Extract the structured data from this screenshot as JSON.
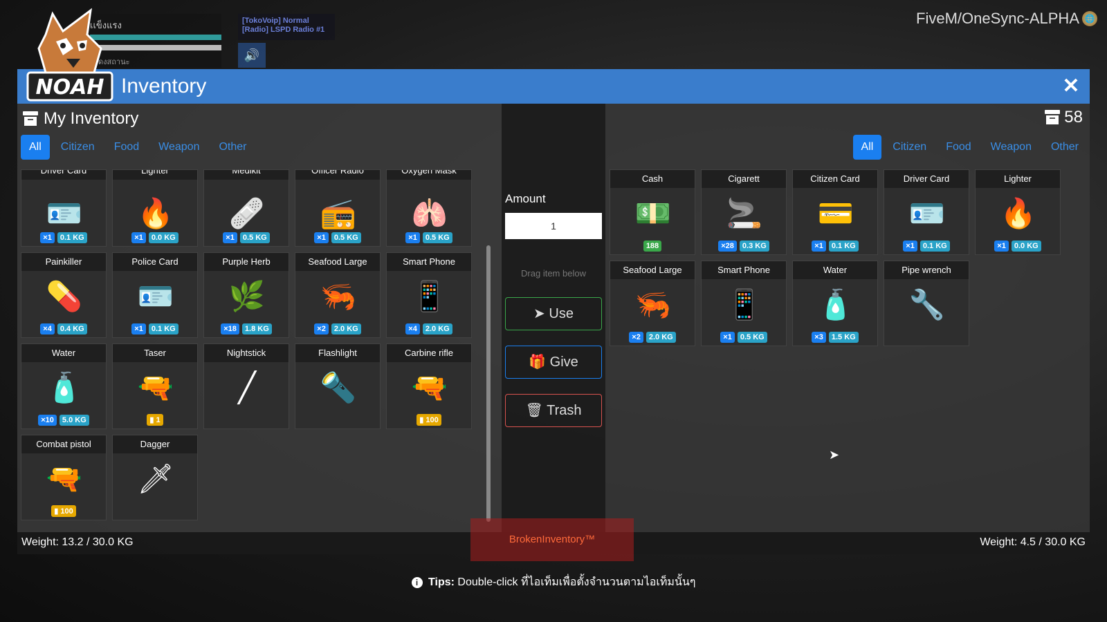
{
  "hud": {
    "label": "เเข็งแรง",
    "subtext": "ค้างไว้เพื่อแสดงสถานะ",
    "radio_line1": "[TokoVoip] Normal",
    "radio_line2": "[Radio] LSPD Radio #1",
    "server_name": "FiveM/OneSync-ALPHA"
  },
  "header": {
    "logo_text": "NOAH",
    "title": "Inventory"
  },
  "left": {
    "title": "My Inventory",
    "tabs": [
      "All",
      "Citizen",
      "Food",
      "Weapon",
      "Other"
    ],
    "items": [
      {
        "name": "Driver Card",
        "qty": "×1",
        "wt": "0.1 KG",
        "icon": "id-card-icon",
        "glyph": "🪪"
      },
      {
        "name": "Lighter",
        "qty": "×1",
        "wt": "0.0 KG",
        "icon": "lighter-icon",
        "glyph": "🔥"
      },
      {
        "name": "Medikit",
        "qty": "×1",
        "wt": "0.5 KG",
        "icon": "medkit-icon",
        "glyph": "🩹"
      },
      {
        "name": "Officer Radio",
        "qty": "×1",
        "wt": "0.5 KG",
        "icon": "radio-icon",
        "glyph": "📻"
      },
      {
        "name": "Oxygen Mask",
        "qty": "×1",
        "wt": "0.5 KG",
        "icon": "oxygen-tank-icon",
        "glyph": "🫁"
      },
      {
        "name": "Painkiller",
        "qty": "×4",
        "wt": "0.4 KG",
        "icon": "pill-bottle-icon",
        "glyph": "💊"
      },
      {
        "name": "Police Card",
        "qty": "×1",
        "wt": "0.1 KG",
        "icon": "badge-card-icon",
        "glyph": "🪪"
      },
      {
        "name": "Purple Herb",
        "qty": "×18",
        "wt": "1.8 KG",
        "icon": "herb-icon",
        "glyph": "🌿"
      },
      {
        "name": "Seafood Large",
        "qty": "×2",
        "wt": "2.0 KG",
        "icon": "seafood-box-icon",
        "glyph": "🦐"
      },
      {
        "name": "Smart Phone",
        "qty": "×4",
        "wt": "2.0 KG",
        "icon": "phone-icon",
        "glyph": "📱"
      },
      {
        "name": "Water",
        "qty": "×10",
        "wt": "5.0 KG",
        "icon": "water-bottle-icon",
        "glyph": "🧴"
      },
      {
        "name": "Taser",
        "ammo": "1",
        "icon": "taser-icon",
        "glyph": "🔫"
      },
      {
        "name": "Nightstick",
        "icon": "nightstick-icon",
        "glyph": "╱"
      },
      {
        "name": "Flashlight",
        "icon": "flashlight-icon",
        "glyph": "🔦"
      },
      {
        "name": "Carbine rifle",
        "ammo": "100",
        "icon": "rifle-icon",
        "glyph": "🔫"
      },
      {
        "name": "Combat pistol",
        "ammo": "100",
        "icon": "pistol-icon",
        "glyph": "🔫"
      },
      {
        "name": "Dagger",
        "icon": "dagger-icon",
        "glyph": "🗡"
      }
    ],
    "weight": "Weight: 13.2 / 30.0 KG"
  },
  "middle": {
    "amount_label": "Amount",
    "amount_value": "1",
    "drag_hint": "Drag item below",
    "use_label": "Use",
    "give_label": "Give",
    "trash_label": "Trash"
  },
  "right": {
    "count": "58",
    "tabs": [
      "All",
      "Citizen",
      "Food",
      "Weapon",
      "Other"
    ],
    "items": [
      {
        "name": "Cash",
        "cash": "188",
        "icon": "cash-icon",
        "glyph": "💵"
      },
      {
        "name": "Cigarett",
        "qty": "×28",
        "wt": "0.3 KG",
        "icon": "cigarette-pack-icon",
        "glyph": "🚬"
      },
      {
        "name": "Citizen Card",
        "qty": "×1",
        "wt": "0.1 KG",
        "icon": "citizen-card-icon",
        "glyph": "💳"
      },
      {
        "name": "Driver Card",
        "qty": "×1",
        "wt": "0.1 KG",
        "icon": "id-card-icon",
        "glyph": "🪪"
      },
      {
        "name": "Lighter",
        "qty": "×1",
        "wt": "0.0 KG",
        "icon": "lighter-icon",
        "glyph": "🔥"
      },
      {
        "name": "Seafood Large",
        "qty": "×2",
        "wt": "2.0 KG",
        "icon": "seafood-box-icon",
        "glyph": "🦐"
      },
      {
        "name": "Smart Phone",
        "qty": "×1",
        "wt": "0.5 KG",
        "icon": "phone-icon",
        "glyph": "📱"
      },
      {
        "name": "Water",
        "qty": "×3",
        "wt": "1.5 KG",
        "icon": "water-bottle-icon",
        "glyph": "🧴"
      },
      {
        "name": "Pipe wrench",
        "icon": "pipe-wrench-icon",
        "glyph": "🔧"
      }
    ],
    "weight": "Weight: 4.5 / 30.0 KG"
  },
  "footer": {
    "brand": "BrokenInventory™",
    "tips_label": "Tips:",
    "tips_text": "Double-click ที่ไอเท็มเพื่อตั้งจำนวนตามไอเท็มนั้นๆ"
  },
  "colors": {
    "header_blue": "#3a7dcc",
    "tab_active": "#1a7ff0",
    "use_green": "#3aa84a",
    "trash_red": "#d9534f",
    "ammo_yellow": "#e6a800"
  }
}
